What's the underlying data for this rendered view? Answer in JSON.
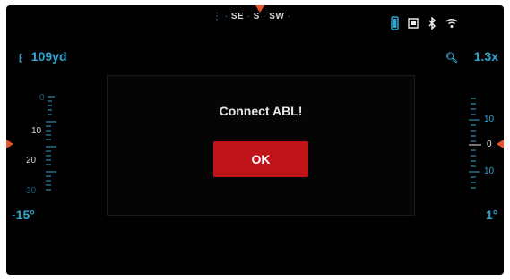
{
  "compass": {
    "left_dots": "⋮ ·",
    "se": "SE",
    "sep1": "·",
    "s": "S",
    "sep2": "·",
    "sw": "SW",
    "right_dot": "·"
  },
  "status": {
    "battery_icon": "battery-icon",
    "sdcard_icon": "sd-card-icon",
    "bluetooth_icon": "bluetooth-icon",
    "wifi_icon": "wifi-icon"
  },
  "range": {
    "value": "109yd"
  },
  "zoom": {
    "value": "1.3x"
  },
  "left_scale": {
    "labels": [
      "0",
      "10",
      "20",
      "30"
    ],
    "angle": "-15°"
  },
  "right_scale": {
    "labels": [
      "10",
      "0",
      "10"
    ],
    "angle": "1°"
  },
  "dialog": {
    "title": "Connect ABL!",
    "ok_label": "OK"
  },
  "colors": {
    "accent": "#2fa6d0",
    "marker": "#e8542b",
    "button": "#c0141a",
    "background": "#000000"
  }
}
